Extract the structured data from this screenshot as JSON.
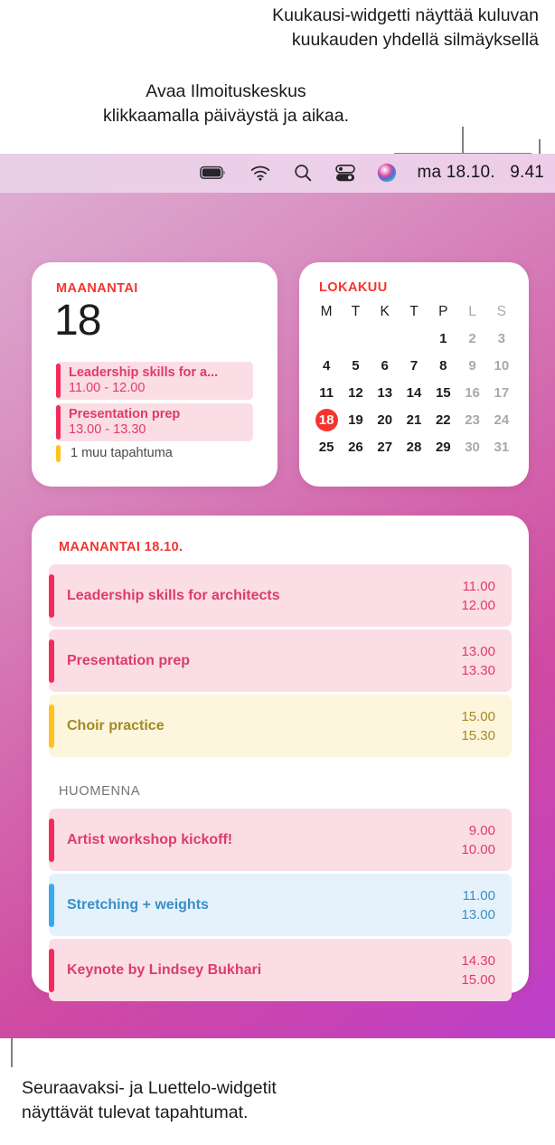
{
  "captions": {
    "top": "Kuukausi-widgetti näyttää kuluvan\nkuukauden yhdellä silmäyksellä",
    "middle": "Avaa Ilmoituskeskus\nklikkaamalla päiväystä ja aikaa.",
    "bottom": "Seuraavaksi- ja Luettelo-widgetit\nnäyttävät tulevat tapahtumat."
  },
  "menubar": {
    "icons": [
      "battery-icon",
      "wifi-icon",
      "search-icon",
      "control-center-icon",
      "siri-icon"
    ],
    "clock": "ma 18.10.   9.41"
  },
  "day_widget": {
    "weekday": "MAANANTAI",
    "day_number": "18",
    "events": [
      {
        "title": "Leadership skills for a...",
        "time": "11.00 - 12.00",
        "accent": "#f42a5a",
        "bg": "#fbdde6",
        "text": "#e03a68"
      },
      {
        "title": "Presentation prep",
        "time": "13.00 - 13.30",
        "accent": "#f42a5a",
        "bg": "#fbdde6",
        "text": "#e03a68"
      }
    ],
    "more_label": "1 muu tapahtuma",
    "more_accent": "#ffc31e"
  },
  "month_widget": {
    "title": "LOKAKUU",
    "weekdays": [
      "M",
      "T",
      "K",
      "T",
      "P",
      "L",
      "S"
    ],
    "weekend_columns": [
      5,
      6
    ],
    "leading_blanks": 4,
    "days": [
      1,
      2,
      3,
      4,
      5,
      6,
      7,
      8,
      9,
      10,
      11,
      12,
      13,
      14,
      15,
      16,
      17,
      18,
      19,
      20,
      21,
      22,
      23,
      24,
      25,
      26,
      27,
      28,
      29,
      30,
      31
    ],
    "today": 18,
    "today_color": "#f5342f"
  },
  "list_widget": {
    "sections": [
      {
        "header": "MAANANTAI 18.10.",
        "header_color": "#f5342f",
        "events": [
          {
            "name": "Leadership skills for architects",
            "start": "11.00",
            "end": "12.00",
            "accent": "#f42a5a",
            "bg": "#fbdde6",
            "text": "#dc3d68"
          },
          {
            "name": "Presentation prep",
            "start": "13.00",
            "end": "13.30",
            "accent": "#f42a5a",
            "bg": "#fbdde6",
            "text": "#dc3d68"
          },
          {
            "name": "Choir practice",
            "start": "15.00",
            "end": "15.30",
            "accent": "#ffc31e",
            "bg": "#fdf5dc",
            "text": "#a28a24"
          }
        ]
      },
      {
        "header": "HUOMENNA",
        "header_color": "#747476",
        "events": [
          {
            "name": "Artist workshop kickoff!",
            "start": "9.00",
            "end": "10.00",
            "accent": "#f42a5a",
            "bg": "#fbdde6",
            "text": "#dc3d68"
          },
          {
            "name": "Stretching + weights",
            "start": "11.00",
            "end": "13.00",
            "accent": "#36aaee",
            "bg": "#e5f2fb",
            "text": "#3a8fc4"
          },
          {
            "name": "Keynote by Lindsey Bukhari",
            "start": "14.30",
            "end": "15.00",
            "accent": "#f42a5a",
            "bg": "#fbdde6",
            "text": "#dc3d68"
          }
        ]
      }
    ]
  },
  "colors": {
    "desktop_top_left": "#dfb0d4",
    "desktop_bottom_left": "#d1479f",
    "desktop_bottom_right": "#bb3fcb",
    "menubar": "#ebcfe7",
    "callout_line": "#808080"
  }
}
